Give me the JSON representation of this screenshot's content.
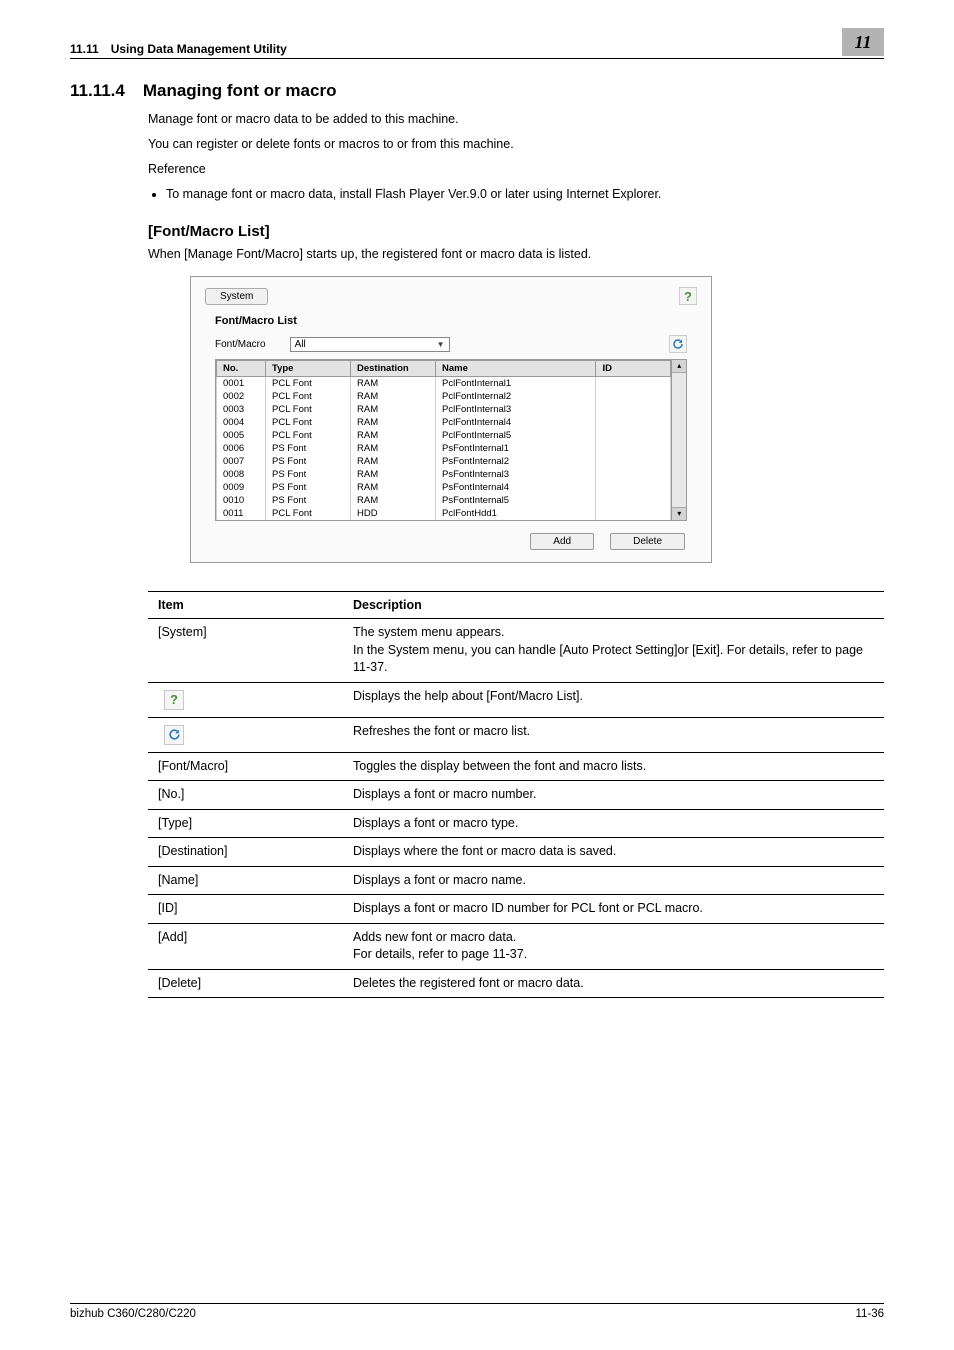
{
  "header": {
    "section_num": "11.11",
    "section_title": "Using Data Management Utility",
    "chapter_chip": "11"
  },
  "heading": {
    "num": "11.11.4",
    "title": "Managing font or macro"
  },
  "intro": {
    "p1": "Manage font or macro data to be added to this machine.",
    "p2": "You can register or delete fonts or macros to or from this machine.",
    "ref_label": "Reference",
    "bullet1": "To manage font or macro data, install Flash Player Ver.9.0 or later using Internet Explorer."
  },
  "sub": {
    "title": "[Font/Macro List]",
    "lead": "When [Manage Font/Macro] starts up, the registered font or macro data is listed."
  },
  "shot": {
    "system_btn": "System",
    "panel_title": "Font/Macro List",
    "filter_label": "Font/Macro",
    "filter_value": "All",
    "columns": {
      "no": "No.",
      "type": "Type",
      "dest": "Destination",
      "name": "Name",
      "id": "ID"
    },
    "rows": [
      {
        "no": "0001",
        "type": "PCL Font",
        "dest": "RAM",
        "name": "PclFontInternal1",
        "id": ""
      },
      {
        "no": "0002",
        "type": "PCL Font",
        "dest": "RAM",
        "name": "PclFontInternal2",
        "id": ""
      },
      {
        "no": "0003",
        "type": "PCL Font",
        "dest": "RAM",
        "name": "PclFontInternal3",
        "id": ""
      },
      {
        "no": "0004",
        "type": "PCL Font",
        "dest": "RAM",
        "name": "PclFontInternal4",
        "id": ""
      },
      {
        "no": "0005",
        "type": "PCL Font",
        "dest": "RAM",
        "name": "PclFontInternal5",
        "id": ""
      },
      {
        "no": "0006",
        "type": "PS Font",
        "dest": "RAM",
        "name": "PsFontInternal1",
        "id": ""
      },
      {
        "no": "0007",
        "type": "PS Font",
        "dest": "RAM",
        "name": "PsFontInternal2",
        "id": ""
      },
      {
        "no": "0008",
        "type": "PS Font",
        "dest": "RAM",
        "name": "PsFontInternal3",
        "id": ""
      },
      {
        "no": "0009",
        "type": "PS Font",
        "dest": "RAM",
        "name": "PsFontInternal4",
        "id": ""
      },
      {
        "no": "0010",
        "type": "PS Font",
        "dest": "RAM",
        "name": "PsFontInternal5",
        "id": ""
      },
      {
        "no": "0011",
        "type": "PCL Font",
        "dest": "HDD",
        "name": "PclFontHdd1",
        "id": ""
      }
    ],
    "add_btn": "Add",
    "delete_btn": "Delete"
  },
  "table": {
    "head_item": "Item",
    "head_desc": "Description",
    "rows": [
      {
        "item": "[System]",
        "desc": "The system menu appears.\nIn the System menu, you can handle [Auto Protect Setting]or [Exit]. For details, refer to page 11-37."
      },
      {
        "item": "__HELP_ICON__",
        "desc": "Displays the help about [Font/Macro List]."
      },
      {
        "item": "__REFRESH_ICON__",
        "desc": "Refreshes the font or macro list."
      },
      {
        "item": "[Font/Macro]",
        "desc": "Toggles the display between the font and macro lists."
      },
      {
        "item": "[No.]",
        "desc": "Displays a font or macro number."
      },
      {
        "item": "[Type]",
        "desc": "Displays a font or macro type."
      },
      {
        "item": "[Destination]",
        "desc": "Displays where the font or macro data is saved."
      },
      {
        "item": "[Name]",
        "desc": "Displays a font or macro name."
      },
      {
        "item": "[ID]",
        "desc": "Displays a font or macro ID number for PCL font or PCL macro."
      },
      {
        "item": "[Add]",
        "desc": "Adds new font or macro data.\nFor details, refer to page 11-37."
      },
      {
        "item": "[Delete]",
        "desc": "Deletes the registered font or macro data."
      }
    ]
  },
  "footer": {
    "left": "bizhub C360/C280/C220",
    "right": "11-36"
  }
}
